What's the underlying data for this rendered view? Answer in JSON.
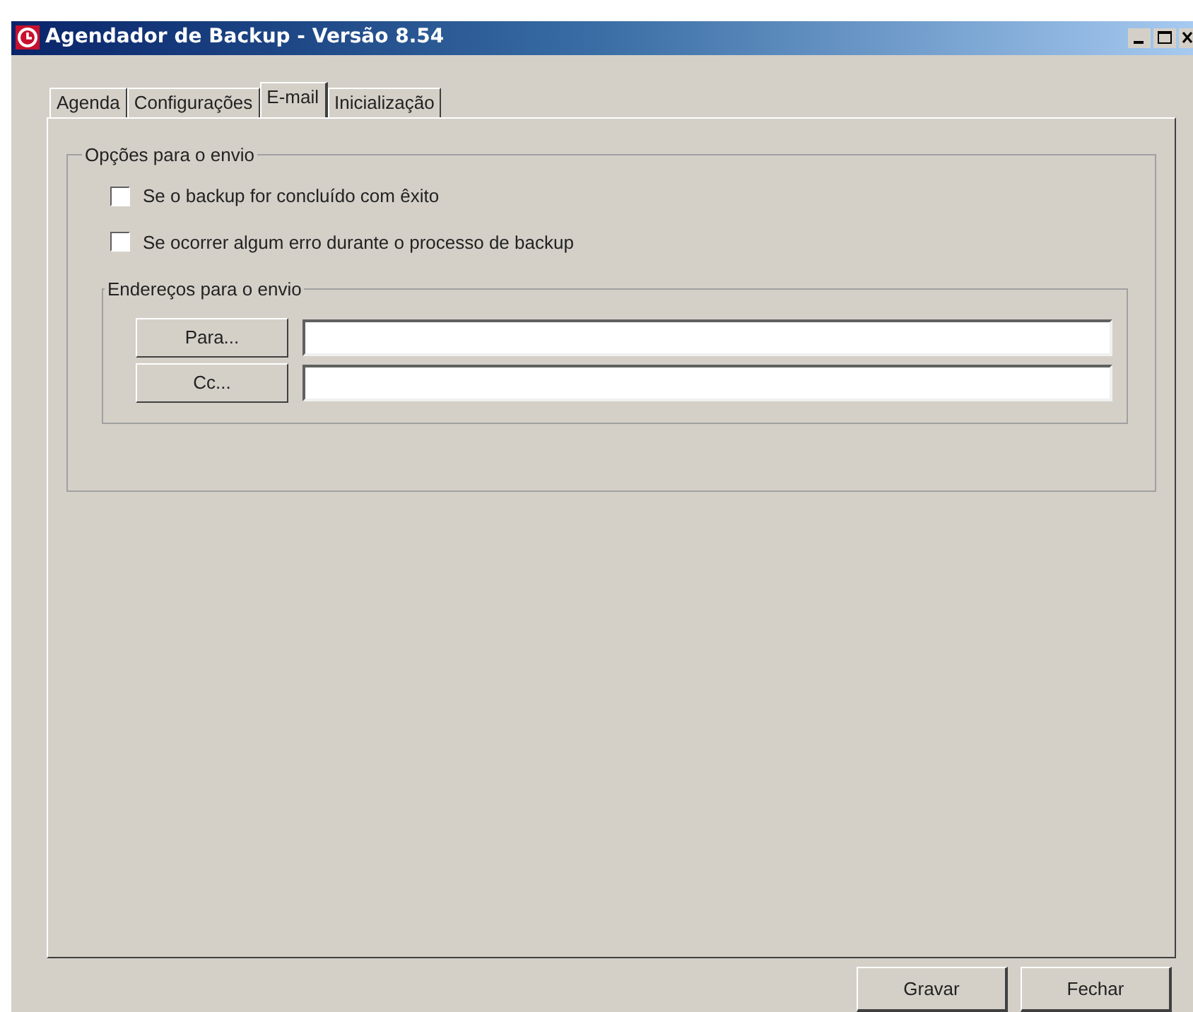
{
  "window": {
    "title": "Agendador de Backup - Versão 8.54"
  },
  "tabs": [
    {
      "label": "Agenda",
      "selected": false
    },
    {
      "label": "Configurações",
      "selected": false
    },
    {
      "label": "E-mail",
      "selected": true
    },
    {
      "label": "Inicialização",
      "selected": false
    }
  ],
  "send_options": {
    "title": "Opções para o envio",
    "checkboxes": [
      {
        "label": "Se o backup for concluído com êxito",
        "checked": false
      },
      {
        "label": "Se ocorrer algum erro durante o processo de backup",
        "checked": false
      }
    ],
    "addresses": {
      "title": "Endereços para o envio",
      "rows": [
        {
          "button": "Para..."
        },
        {
          "button": "Cc..."
        }
      ]
    }
  },
  "buttons": [
    "Gravar",
    "Fechar"
  ]
}
